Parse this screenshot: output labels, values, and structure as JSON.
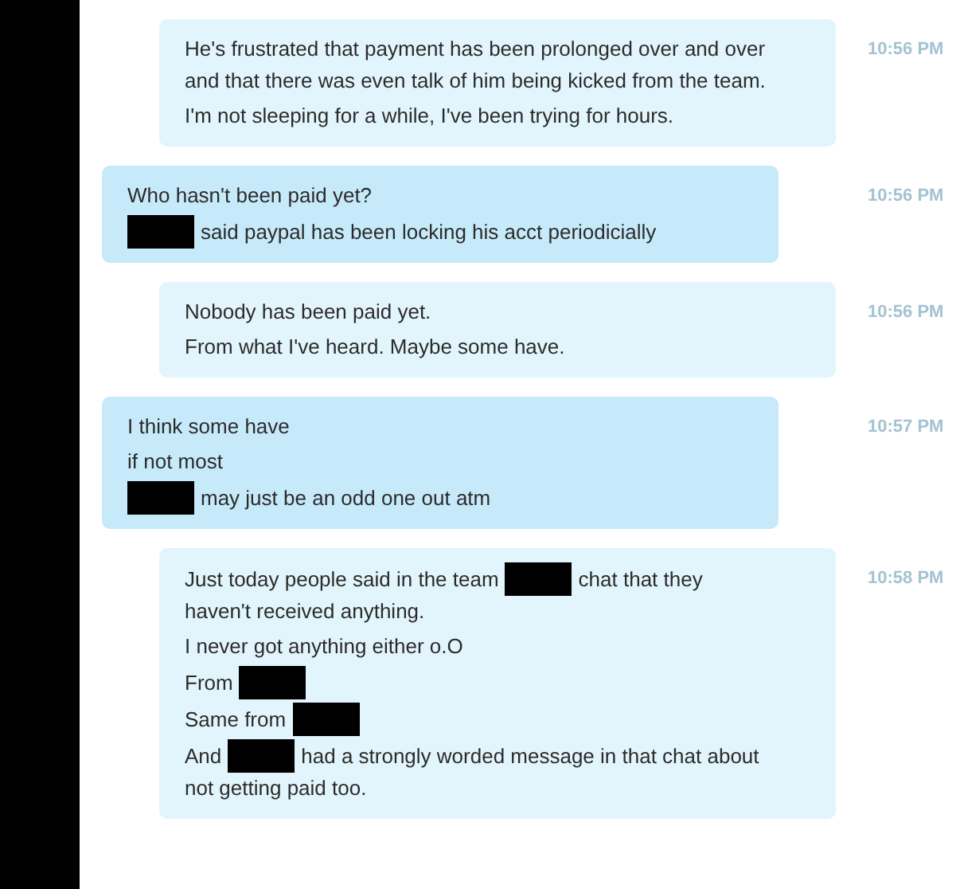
{
  "messages": [
    {
      "kind": "outgoing",
      "time": "10:56 PM",
      "paragraphs": [
        [
          [
            {
              "kind": "text",
              "text": "He's frustrated that payment has been prolonged over and over and that there was even talk of him being kicked from the team."
            }
          ]
        ],
        [
          [
            {
              "kind": "text",
              "text": "I'm not sleeping for a while, I've been trying for hours."
            }
          ]
        ]
      ]
    },
    {
      "kind": "incoming",
      "time": "10:56 PM",
      "paragraphs": [
        [
          [
            {
              "kind": "text",
              "text": "Who hasn't been paid yet?"
            }
          ]
        ],
        [
          [
            {
              "kind": "redaction"
            },
            {
              "kind": "text",
              "text": "said paypal has been locking his acct periodicially"
            }
          ]
        ]
      ]
    },
    {
      "kind": "outgoing",
      "time": "10:56 PM",
      "paragraphs": [
        [
          [
            {
              "kind": "text",
              "text": "Nobody has been paid yet."
            }
          ]
        ],
        [
          [
            {
              "kind": "text",
              "text": "From what I've heard. Maybe some have."
            }
          ]
        ]
      ]
    },
    {
      "kind": "incoming",
      "time": "10:57 PM",
      "paragraphs": [
        [
          [
            {
              "kind": "text",
              "text": "I think some have"
            }
          ]
        ],
        [
          [
            {
              "kind": "text",
              "text": "if not most"
            }
          ]
        ],
        [
          [
            {
              "kind": "redaction"
            },
            {
              "kind": "text",
              "text": "may just be an odd one out atm"
            }
          ]
        ]
      ]
    },
    {
      "kind": "outgoing",
      "time": "10:58 PM",
      "paragraphs": [
        [
          [
            {
              "kind": "text",
              "text": "Just today people said in the team"
            },
            {
              "kind": "redaction"
            },
            {
              "kind": "text",
              "text": "chat that they"
            }
          ],
          [
            {
              "kind": "text",
              "text": "haven't received anything."
            }
          ]
        ],
        [
          [
            {
              "kind": "text",
              "text": "I never got anything either o.O"
            }
          ]
        ],
        [
          [
            {
              "kind": "text",
              "text": "From"
            },
            {
              "kind": "redaction"
            }
          ]
        ],
        [
          [
            {
              "kind": "text",
              "text": "Same from"
            },
            {
              "kind": "redaction"
            }
          ]
        ],
        [
          [
            {
              "kind": "text",
              "text": "And"
            },
            {
              "kind": "redaction"
            },
            {
              "kind": "text",
              "text": "had a strongly worded message in that chat about"
            }
          ],
          [
            {
              "kind": "text",
              "text": "not getting paid too."
            }
          ]
        ]
      ]
    }
  ]
}
